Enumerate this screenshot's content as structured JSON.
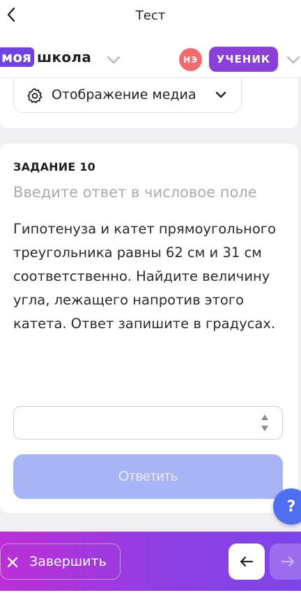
{
  "topbar": {
    "title": "Тест",
    "back_icon": "chevron-left-icon"
  },
  "header": {
    "logo_part1": "моя",
    "logo_part2": "школа",
    "user_initials": "НЭ",
    "role": "УЧЕНИК",
    "colors": {
      "logo_accent": "#7042e6",
      "initials_bg": "#f16b6b",
      "role_bg": "#8a3fd8"
    }
  },
  "media": {
    "label": "Отображение медиа",
    "icon": "gear-icon"
  },
  "task": {
    "number_label": "ЗАДАНИЕ 10",
    "hint": "Введите ответ в числовое поле",
    "text": "Гипотенуза и катет прямоугольного треугольника равны 62 см и 31 см соответственно. Найдите величину угла, лежащего напротив этого катета. Ответ запишите в градусах.",
    "answer_value": "",
    "submit_label": "Ответить",
    "colors": {
      "submit_bg": "#a7b5f6",
      "hint": "#a9a9b3"
    }
  },
  "help": {
    "label": "?"
  },
  "bottombar": {
    "finish_label": "Завершить",
    "colors": {
      "gradient_start": "#bb2fd6",
      "gradient_end": "#7d45ea"
    }
  }
}
